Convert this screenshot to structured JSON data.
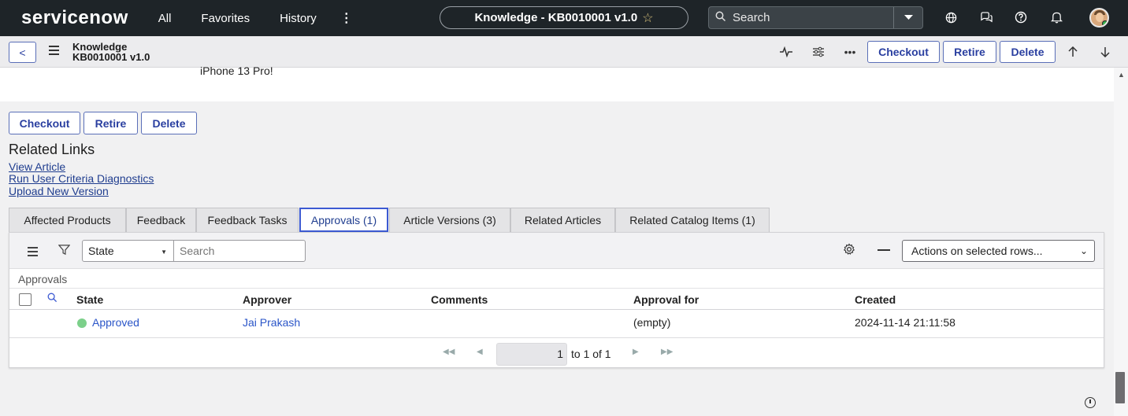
{
  "topnav": {
    "logo": "servicenow",
    "links": [
      "All",
      "Favorites",
      "History"
    ],
    "more_icon": "more-vertical-icon",
    "record_pill": "Knowledge - KB0010001 v1.0",
    "favorite_icon": "☆",
    "search_placeholder": "Search",
    "icons": [
      "globe-icon",
      "chat-icon",
      "help-icon",
      "bell-icon"
    ]
  },
  "subheader": {
    "back_icon": "<",
    "title_line1": "Knowledge",
    "title_line2": "KB0010001 v1.0",
    "buttons": [
      "Checkout",
      "Retire",
      "Delete"
    ],
    "icons": [
      "activity-icon",
      "settings-sliders-icon",
      "more-horizontal-icon",
      "arrow-up-icon",
      "arrow-down-icon"
    ]
  },
  "article": {
    "partial_text": "iPhone 13 Pro!"
  },
  "form_buttons": [
    "Checkout",
    "Retire",
    "Delete"
  ],
  "related_links": {
    "title": "Related Links",
    "links": [
      "View Article",
      "Run User Criteria Diagnostics",
      "Upload New Version"
    ]
  },
  "tabs": [
    {
      "label": "Affected Products",
      "active": false
    },
    {
      "label": "Feedback",
      "active": false
    },
    {
      "label": "Feedback Tasks",
      "active": false
    },
    {
      "label": "Approvals (1)",
      "active": true
    },
    {
      "label": "Article Versions (3)",
      "active": false
    },
    {
      "label": "Related Articles",
      "active": false
    },
    {
      "label": "Related Catalog Items (1)",
      "active": false
    }
  ],
  "approvals": {
    "filter_field": "State",
    "search_placeholder": "Search",
    "actions_label": "Actions on selected rows...",
    "list_title": "Approvals",
    "columns": [
      "State",
      "Approver",
      "Comments",
      "Approval for",
      "Created"
    ],
    "rows": [
      {
        "state": "Approved",
        "approver": "Jai Prakash",
        "comments": "",
        "approval_for": "(empty)",
        "created": "2024-11-14 21:11:58"
      }
    ],
    "pager": {
      "current": "1",
      "summary": "to 1 of 1"
    }
  },
  "colors": {
    "nav_bg": "#1e2428",
    "accent": "#3c5ad2",
    "approved_dot": "#7cd08a"
  }
}
